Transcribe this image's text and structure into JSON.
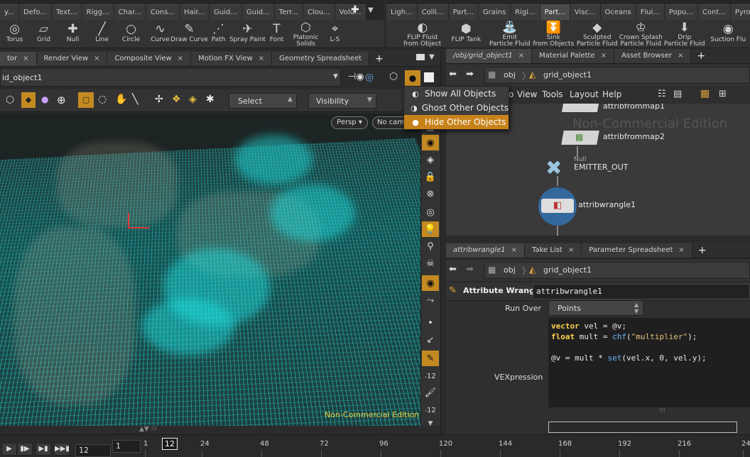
{
  "left_shelf_tabs": [
    "y...",
    "Defo...",
    "Text...",
    "Rigg...",
    "Char...",
    "Cons...",
    "Hair...",
    "Guid...",
    "Guid...",
    "Terr...",
    "Clou...",
    "Volu..."
  ],
  "right_shelf_tabs": [
    "Ligh...",
    "Colli...",
    "Part...",
    "Grains",
    "Rigi...",
    "Part...",
    "Visc...",
    "Oceans",
    "Flui...",
    "Popu...",
    "Cont...",
    "Pyro..."
  ],
  "right_shelf_active": "Part...",
  "left_tools": [
    {
      "label": "Torus",
      "icon": "torus-icon",
      "glyph": "◎"
    },
    {
      "label": "Grid",
      "icon": "grid-icon",
      "glyph": "▱"
    },
    {
      "label": "Null",
      "icon": "null-icon",
      "glyph": "✚"
    },
    {
      "label": "Line",
      "icon": "line-icon",
      "glyph": "╱"
    },
    {
      "label": "Circle",
      "icon": "circle-icon",
      "glyph": "○"
    },
    {
      "label": "Curve",
      "icon": "curve-icon",
      "glyph": "∿"
    },
    {
      "label": "Draw Curve",
      "icon": "draw-curve-icon",
      "glyph": "✎"
    },
    {
      "label": "Path",
      "icon": "path-icon",
      "glyph": "⋰"
    },
    {
      "label": "Spray Paint",
      "icon": "spray-paint-icon",
      "glyph": "✈"
    },
    {
      "label": "Font",
      "icon": "font-icon",
      "glyph": "T"
    },
    {
      "label": "Platonic\nSolids",
      "icon": "platonic-icon",
      "glyph": "⬡"
    },
    {
      "label": "L-S",
      "icon": "lsystem-icon",
      "glyph": "⌖"
    }
  ],
  "right_tools": [
    {
      "label": "FLIP Fluid\nfrom Object",
      "icon": "flip-fluid-icon",
      "glyph": "◐"
    },
    {
      "label": "FLIP Tank",
      "icon": "flip-tank-icon",
      "glyph": "⬢"
    },
    {
      "label": "Emit\nParticle Fluid",
      "icon": "emit-icon",
      "glyph": "⛲"
    },
    {
      "label": "Sink\nfrom Objects",
      "icon": "sink-icon",
      "glyph": "⏬"
    },
    {
      "label": "Sculpted\nParticle Fluid",
      "icon": "sculpted-icon",
      "glyph": "◆"
    },
    {
      "label": "Crown Splash\nParticle Fluid",
      "icon": "crown-icon",
      "glyph": "♔"
    },
    {
      "label": "Drip\nParticle Fluid",
      "icon": "drip-icon",
      "glyph": "⬇"
    },
    {
      "label": "Suction Flu",
      "icon": "suction-icon",
      "glyph": "◉"
    }
  ],
  "viewer_tabs": [
    "tor",
    "Render View",
    "Composite View",
    "Motion FX View",
    "Geometry Spreadsheet"
  ],
  "viewer_path": "id_object1",
  "select_mode": "Select",
  "visibility_label": "Visibility",
  "persp_label": "Persp ▾",
  "cam_label": "No cam",
  "vis_menu": [
    {
      "label": "Show All Objects",
      "selected": false
    },
    {
      "label": "Ghost Other Objects",
      "selected": false
    },
    {
      "label": "Hide Other Objects",
      "selected": true
    }
  ],
  "watermark": "Non-Commercial Edition",
  "net_tabs": [
    "/obj/grid_object1",
    "Material Palette",
    "Asset Browser"
  ],
  "net_path": {
    "root": "obj",
    "node": "grid_object1"
  },
  "net_menu": [
    "o",
    "View",
    "Tools",
    "Layout",
    "Help"
  ],
  "net_nodes": [
    {
      "name": "attribfrommap1"
    },
    {
      "name": "attribfrommap2"
    },
    {
      "name": "EMITTER_OUT",
      "type": "Null"
    },
    {
      "name": "attribwrangle1"
    }
  ],
  "param_tabs": [
    "attribwrangle1",
    "Take List",
    "Parameter Spreadsheet"
  ],
  "param_path": {
    "root": "obj",
    "node": "grid_object1"
  },
  "param_type": "Attribute Wrangle",
  "param_name": "attribwrangle1",
  "run_over_label": "Run Over",
  "run_over_value": "Points",
  "vex_label": "VEXpression",
  "code_lines": [
    [
      {
        "t": "vector",
        "c": "kw"
      },
      {
        "t": " vel = @v;",
        "c": ""
      }
    ],
    [
      {
        "t": "float",
        "c": "kw"
      },
      {
        "t": " mult = ",
        "c": ""
      },
      {
        "t": "chf",
        "c": "fn"
      },
      {
        "t": "(",
        "c": ""
      },
      {
        "t": "\"multiplier\"",
        "c": "st"
      },
      {
        "t": ");",
        "c": ""
      }
    ],
    [
      {
        "t": "",
        "c": ""
      }
    ],
    [
      {
        "t": "@v = mult * ",
        "c": ""
      },
      {
        "t": "set",
        "c": "fn"
      },
      {
        "t": "(vel.x, 0, vel.y);",
        "c": ""
      }
    ]
  ],
  "timeline": {
    "current_frame": "12",
    "start": "1",
    "frame_field": "12",
    "ticks": [
      "1",
      "24",
      "48",
      "72",
      "96",
      "120",
      "144",
      "168",
      "192",
      "216",
      "24"
    ]
  }
}
